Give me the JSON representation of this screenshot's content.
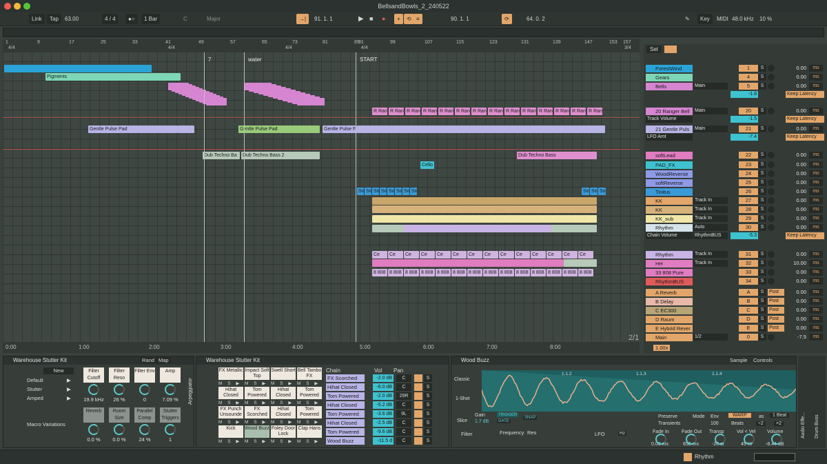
{
  "window": {
    "title": "BellsandBowls_2_240522"
  },
  "transport": {
    "link": "Link",
    "tap": "Tap",
    "tempo": "63.00",
    "signature": "4 / 4",
    "quantize": "1 Bar",
    "key": "C",
    "scale": "Major",
    "position": "91.  1.  1",
    "loop_start": "90.  1.  1",
    "loop_length": "64.  0.  2",
    "key_btn": "Key",
    "midi": "MIDI",
    "sample_rate": "48.0 kHz",
    "cpu": "10 %"
  },
  "ruler": [
    "1",
    "9",
    "17",
    "25",
    "33",
    "41",
    "49",
    "57",
    "65",
    "73",
    "81",
    "89",
    "91",
    "99",
    "107",
    "115",
    "123",
    "131",
    "139",
    "147",
    "153",
    "157"
  ],
  "ruler_sig": [
    "4/4",
    "4/4",
    "4/4",
    "4/4",
    "3/4"
  ],
  "locators": {
    "a": "7",
    "b": "water",
    "c": "START"
  },
  "timeline": [
    "0:00",
    "1:00",
    "2:00",
    "3:00",
    "4:00",
    "5:00",
    "6:00",
    "7:00",
    "8:00"
  ],
  "page_indicator": "2/1",
  "clips": {
    "pigments": "Pigments",
    "gentle": "Gentle Pulse Pad",
    "gentle2": "Gentle Pulse F",
    "dub1": "Dub Techno Ba",
    "dub2": "Dub Techno Bass 2",
    "dub3": "Dub Techno Bass",
    "cello": "Cello",
    "ranger": "R Rang",
    "soft": "Soft Ti",
    "ce": "Ce",
    "e808": "8 808"
  },
  "mixer": {
    "set_label": "Set",
    "tracks": [
      {
        "name": "ForestWind",
        "num": "1",
        "vol": "0.00",
        "color": "#2aa4d8"
      },
      {
        "name": "Gears",
        "num": "4",
        "vol": "0.00",
        "color": "#7dd6b5"
      },
      {
        "name": "Bells",
        "num": "5",
        "vol": "0.00",
        "color": "#d685d1",
        "io": "Main",
        "sub": "-1.8",
        "latency": "Keep Latency"
      },
      {
        "name": "20 Ranger Bell",
        "num": "20",
        "vol": "0.00",
        "color": "#d685d1",
        "io": "Main",
        "sub": "-1.5",
        "sub_label": "Track Volume",
        "latency": "Keep Latency"
      },
      {
        "name": "21 Gentle Puls",
        "num": "21",
        "vol": "0.00",
        "color": "#b9b4e6",
        "io": "Main",
        "sub": "-7.4",
        "sub_label": "LFO Amt",
        "latency": "Keep Latency"
      },
      {
        "name": "softLead",
        "num": "22",
        "vol": "0.00",
        "color": "#e07cc0"
      },
      {
        "name": "PAD_FX",
        "num": "23",
        "vol": "0.00",
        "color": "#3fc2d0"
      },
      {
        "name": "WoodReverse",
        "num": "24",
        "vol": "0.00",
        "color": "#8e9ae6"
      },
      {
        "name": "softReverse",
        "num": "25",
        "vol": "0.00",
        "color": "#8e9ae6"
      },
      {
        "name": "Tinitus",
        "num": "26",
        "vol": "0.00",
        "color": "#3a9ad8"
      },
      {
        "name": "KK",
        "num": "27",
        "vol": "0.00",
        "color": "#e2a66a",
        "io": "Track In"
      },
      {
        "name": "KK",
        "num": "28",
        "vol": "0.00",
        "color": "#d6b27a",
        "io": "Track In"
      },
      {
        "name": "KK_sub",
        "num": "29",
        "vol": "0.00",
        "color": "#efe6a8",
        "io": "Track In"
      },
      {
        "name": "Rhythm",
        "num": "30",
        "vol": "0.00",
        "color": "#d6e3ea",
        "io": "Auto",
        "sub": "-5.3",
        "sub_label": "Chain Volume",
        "io2": "RhythmBUS",
        "latency": "Keep Latency"
      },
      {
        "name": "Rhythm",
        "num": "31",
        "vol": "0.00",
        "color": "#c9b4e6",
        "io": "Track In"
      },
      {
        "name": "HH",
        "num": "32",
        "vol": "10.00",
        "color": "#e07cc0",
        "io": "Track In"
      },
      {
        "name": "33 808 Pure",
        "num": "33",
        "vol": "0.00",
        "color": "#e07cc0"
      },
      {
        "name": "RhythmBUS",
        "num": "34",
        "vol": "0.00",
        "color": "#e05a5a"
      },
      {
        "name": "A Reverb",
        "num": "A",
        "vol": "0.00",
        "color": "#e2a66a",
        "post": "Post"
      },
      {
        "name": "B Delay",
        "num": "B",
        "vol": "0.00",
        "color": "#e8b8a8",
        "post": "Post"
      },
      {
        "name": "C EC300",
        "num": "C",
        "vol": "0.00",
        "color": "#b7a575",
        "post": "Post"
      },
      {
        "name": "D Raum",
        "num": "D",
        "vol": "0.00",
        "color": "#e2a66a",
        "post": "Post"
      },
      {
        "name": "E Hybrid Rever",
        "num": "E",
        "vol": "0.00",
        "color": "#e2a66a",
        "post": "Post"
      },
      {
        "name": "Main",
        "num": "0",
        "vol": "-7.5",
        "color": "#e2a66a",
        "io": "1/2"
      }
    ],
    "zoom": "1.00x"
  },
  "device1": {
    "title": "Warehouse Stutter Kit",
    "rand": "Rand",
    "map": "Map",
    "new": "New",
    "variations": [
      "Default",
      "Stutter",
      "Amped"
    ],
    "macro_variations": "Macro Variations",
    "macros": [
      {
        "label": "Filter Cutoff",
        "value": "19.9 kHz"
      },
      {
        "label": "Filter Reso",
        "value": "26 %"
      },
      {
        "label": "Filter Env",
        "value": "0"
      },
      {
        "label": "Amp",
        "value": "7.09 %"
      },
      {
        "label": "Reverb",
        "value": "0.0 %"
      },
      {
        "label": "Room Size",
        "value": "0.0 %"
      },
      {
        "label": "Parallel Comp",
        "value": "24 %"
      },
      {
        "label": "Stutter Triggers",
        "value": "1"
      }
    ],
    "arp": "Arpeggiator"
  },
  "device2": {
    "title": "Warehouse Stutter Kit",
    "pads": [
      "FX Metallic",
      "Impact Soft Top",
      "Swell Short",
      "Bell Tambo FX",
      "Hihat Closed",
      "Tom Powered",
      "Hihat Closed",
      "Tom Powered",
      "FX Punch Unsounde",
      "FX Scorched",
      "Hihat Closed",
      "Tom Powered",
      "Kick",
      "Wood Buzz",
      "Foley Door Lock",
      "Clap Hans"
    ],
    "chain_header": "Chain",
    "vol_header": "Vol",
    "pan_header": "Pan",
    "chains": [
      {
        "name": "FX Scorched",
        "vol": "-2.0 dB",
        "pan": "C"
      },
      {
        "name": "Hihat Closed",
        "vol": "-6.0 dB",
        "pan": "C"
      },
      {
        "name": "Tom Powered",
        "vol": "-2.0 dB",
        "pan": "29R"
      },
      {
        "name": "Hihat Closed",
        "vol": "-5.2 dB",
        "pan": "C"
      },
      {
        "name": "Tom Powered",
        "vol": "-3.6 dB",
        "pan": "9L"
      },
      {
        "name": "Hihat Closed",
        "vol": "-2.5 dB",
        "pan": "C"
      },
      {
        "name": "Tom Powered",
        "vol": "-9.6 dB",
        "pan": "C"
      },
      {
        "name": "Wood Buzz",
        "vol": "-11.5 d",
        "pan": "C"
      }
    ]
  },
  "device3": {
    "title": "Wood Buzz",
    "sample": "Sample",
    "controls": "Controls",
    "classic": "Classic",
    "oneshot": "1-Shot",
    "slice": "Slice",
    "gain_label": "Gain",
    "gain": "1.7 dB",
    "trigger": "TRIGGER",
    "gate": "GATE",
    "snap": "SNAP",
    "preserve_label": "Preserve",
    "preserve": "Transients",
    "mode_label": "Mode",
    "env_label": "Env",
    "env": "100",
    "warp": "WARP",
    "as": "as",
    "beat": "1 Beat",
    "beats": "Beats",
    "div2": "÷2",
    "mul2": "×2",
    "markers": [
      "1.1.2",
      "1.1.3",
      "1.1.4"
    ],
    "filter": "Filter",
    "frequency": "Frequency",
    "res": "Res",
    "lfo": "LFO",
    "hz": "Hz",
    "fade_in_label": "Fade In",
    "fade_in": "0.00 ms",
    "fade_out_label": "Fade Out",
    "fade_out": "658 ms",
    "transp_label": "Transp",
    "transp": "-20 st",
    "volvel_label": "Vol < Vel",
    "volvel": "45 %",
    "volume_label": "Volume",
    "volume": "-8.44 dB"
  },
  "side": {
    "audio": "Audio Effe...",
    "drum": "Drum Buss"
  },
  "status": {
    "track": "Rhythm"
  }
}
